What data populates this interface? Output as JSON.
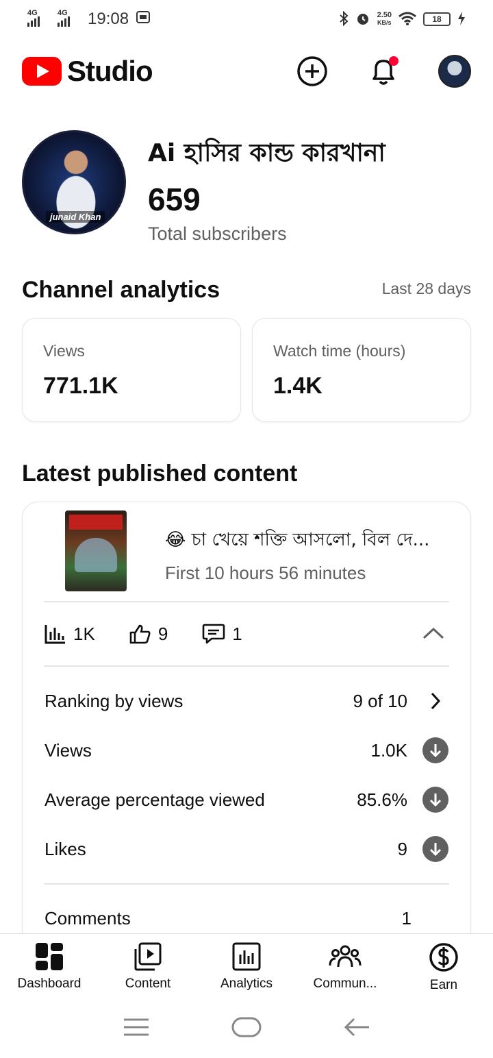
{
  "status_bar": {
    "time": "19:08",
    "net1": "4G",
    "net2": "4G",
    "speed_value": "2.50",
    "speed_unit": "KB/s",
    "battery": "18"
  },
  "app": {
    "logo_text": "Studio",
    "brand_color": "#ff0000"
  },
  "channel": {
    "name": "Ai হাসির কান্ড কারখানা",
    "subscribers": "659",
    "subscribers_label": "Total subscribers",
    "avatar_tag": "junaid Khan"
  },
  "analytics": {
    "title": "Channel analytics",
    "range": "Last 28 days",
    "cards": [
      {
        "label": "Views",
        "value": "771.1K"
      },
      {
        "label": "Watch time (hours)",
        "value": "1.4K"
      }
    ]
  },
  "latest": {
    "title": "Latest published content",
    "video": {
      "title": "😂 চা খেয়ে শক্তি আসলো, বিল দে...",
      "subtitle": "First 10 hours 56 minutes"
    },
    "metrics": {
      "views": "1K",
      "likes": "9",
      "comments": "1"
    },
    "details": [
      {
        "label": "Ranking by views",
        "value": "9 of 10",
        "indicator": "chevron-right-icon"
      },
      {
        "label": "Views",
        "value": "1.0K",
        "indicator": "arrow-down-circle-icon"
      },
      {
        "label": "Average percentage viewed",
        "value": "85.6%",
        "indicator": "arrow-down-circle-icon"
      },
      {
        "label": "Likes",
        "value": "9",
        "indicator": "arrow-down-circle-icon"
      }
    ],
    "comments": {
      "label": "Comments",
      "value": "1"
    }
  },
  "bottom_nav": [
    {
      "label": "Dashboard",
      "icon": "dashboard-icon"
    },
    {
      "label": "Content",
      "icon": "content-icon"
    },
    {
      "label": "Analytics",
      "icon": "analytics-icon"
    },
    {
      "label": "Commun...",
      "icon": "community-icon"
    },
    {
      "label": "Earn",
      "icon": "earn-icon"
    }
  ]
}
